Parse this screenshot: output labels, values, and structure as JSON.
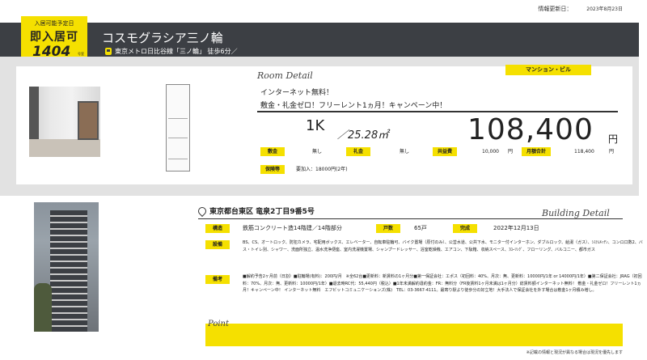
{
  "header": {
    "update_label": "情報更新日：",
    "update_date": "2023年8月23日",
    "move_in": {
      "small": "入居可能予定日",
      "big": "即入居可",
      "number": "1404",
      "suffix": "号室"
    },
    "building_name": "コスモグラシア三ノ輪",
    "station": "東京メトロ日比谷線「三ノ輪」 徒歩6分／"
  },
  "room": {
    "section_label": "Room Detail",
    "type_badge": "マンション・ビル",
    "feature1": "インターネット無料！",
    "feature2": "敷金・礼金ゼロ！フリーレント1ヵ月！キャンペーン中！",
    "layout": "1K",
    "area": "／25.28㎡",
    "rent": "108,400",
    "rent_unit": "円",
    "deposit_label": "敷金",
    "deposit": "無し",
    "key_money_label": "礼金",
    "key_money": "無し",
    "common_fee_label": "共益費",
    "common_fee": "10,000",
    "yen1": "円",
    "monthly_total_label": "月額合計",
    "monthly_total": "118,400",
    "yen2": "円",
    "guarantee_label": "保険等",
    "guarantee": "要加入：18000円(2年)"
  },
  "building": {
    "address": "東京都台東区 竜泉2丁目9番5号",
    "section_label": "Building Detail",
    "structure_label": "構造",
    "structure": "鉄筋コンクリート造14階建／14階部分",
    "units_label": "戸数",
    "units": "65戸",
    "completed_label": "完成",
    "completed": "2022年12月13日",
    "facilities_label": "設備",
    "facilities": "BS、CS、オートロック、防犯カメラ、宅配用ボックス、エレベーター、自転車駐輪可、バイク置場（原付のみ）、公営水道、公共下水、モニター付インターホン、ダブルロック、給湯（ガス）、ｼｽﾃﾑｷｯﾁﾝ、コンロ口数2、バス・トイレ別、シャワー、洗面所独立、温水洗浄便座、室内洗濯機置場、シャンプードレッサー、浴室乾燥機、エアコン、下駄箱、収納スペース、ﾌﾛｰﾘﾝｸﾞ、フローリング、バルコニー、都市ガス",
    "notes_label": "備考",
    "notes": "■解約予告2ヶ月前（日割）■駐輪場(有料)：200円/月　※全62台■更新料：新賃料の1ヶ月分■第一保証会社：エポス（初回料：40%、月次：無、更新料：10000円/1年 or 14000円/1年）■第二保証会社：JRAG（初回料：70%、月次：無、更新料：10000円/1年）■退去時RC代：55,440円（税込）■1年未満解約違約金：FR：無料分（FR後賃料1ヶ月未満は1ヶ月分）総賃料額インターネット無料！ 敷金・礼金ゼロ！フリーレント1ヵ月！キャンペーン中！ インターネット無料　エフビットコミュニケーションズ(株)　TEL：03-3667-4111。最寄り駅より徒歩分の好立地！大手法人で保証会社を外す場合は敷金1ヶ月積み増し。"
  },
  "point": {
    "label": "Point"
  },
  "footnote": "※記載の情報と現況が異なる場合は現況を優先します",
  "colors": {
    "accent": "#f5e000",
    "dark_bar": "#3c3f44",
    "panel": "#e2e2e2"
  }
}
